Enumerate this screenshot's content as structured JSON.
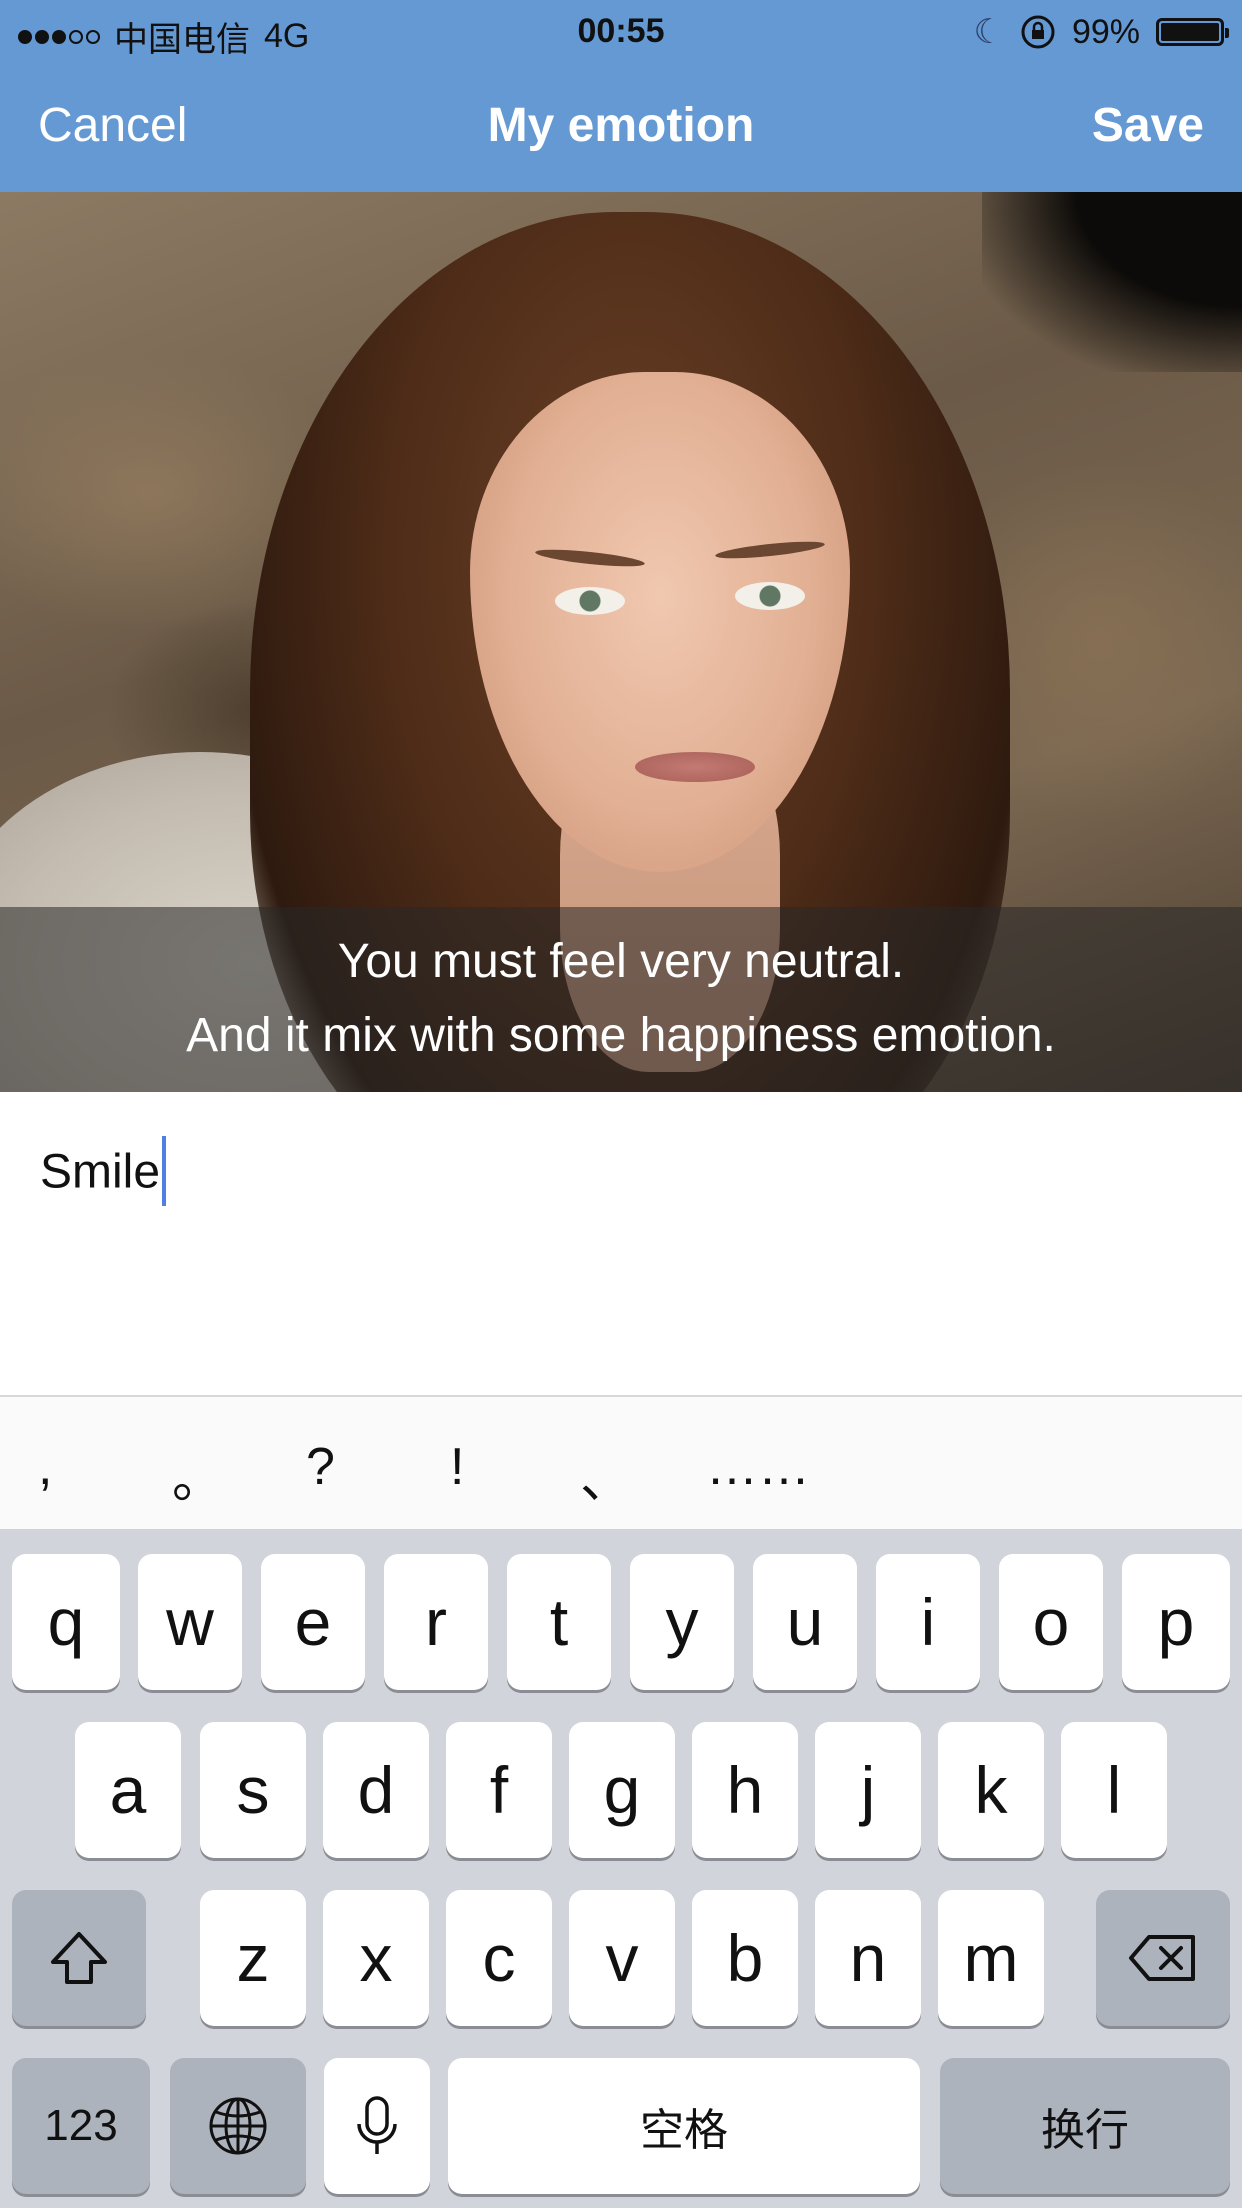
{
  "status_bar": {
    "carrier": "中国电信",
    "network": "4G",
    "time": "00:55",
    "battery": "99%",
    "signal_bars_filled": 3,
    "signal_bars_total": 5
  },
  "nav": {
    "cancel_label": "Cancel",
    "title": "My emotion",
    "save_label": "Save"
  },
  "photo": {
    "caption_line1": "You must feel very neutral.",
    "caption_line2": "And it mix with some happiness emotion."
  },
  "entry": {
    "value": "Smile"
  },
  "suggestions": [
    ",",
    "。",
    "?",
    "!",
    "、",
    "……"
  ],
  "keyboard": {
    "row1": [
      "q",
      "w",
      "e",
      "r",
      "t",
      "y",
      "u",
      "i",
      "o",
      "p"
    ],
    "row2": [
      "a",
      "s",
      "d",
      "f",
      "g",
      "h",
      "j",
      "k",
      "l"
    ],
    "row3": [
      "z",
      "x",
      "c",
      "v",
      "b",
      "n",
      "m"
    ],
    "numbers_label": "123",
    "space_label": "空格",
    "return_label": "换行"
  },
  "colors": {
    "nav_bar": "#6499d3",
    "caret": "#4f7fe0",
    "keyboard_bg": "#d1d5db",
    "function_key": "#adb3bc"
  }
}
